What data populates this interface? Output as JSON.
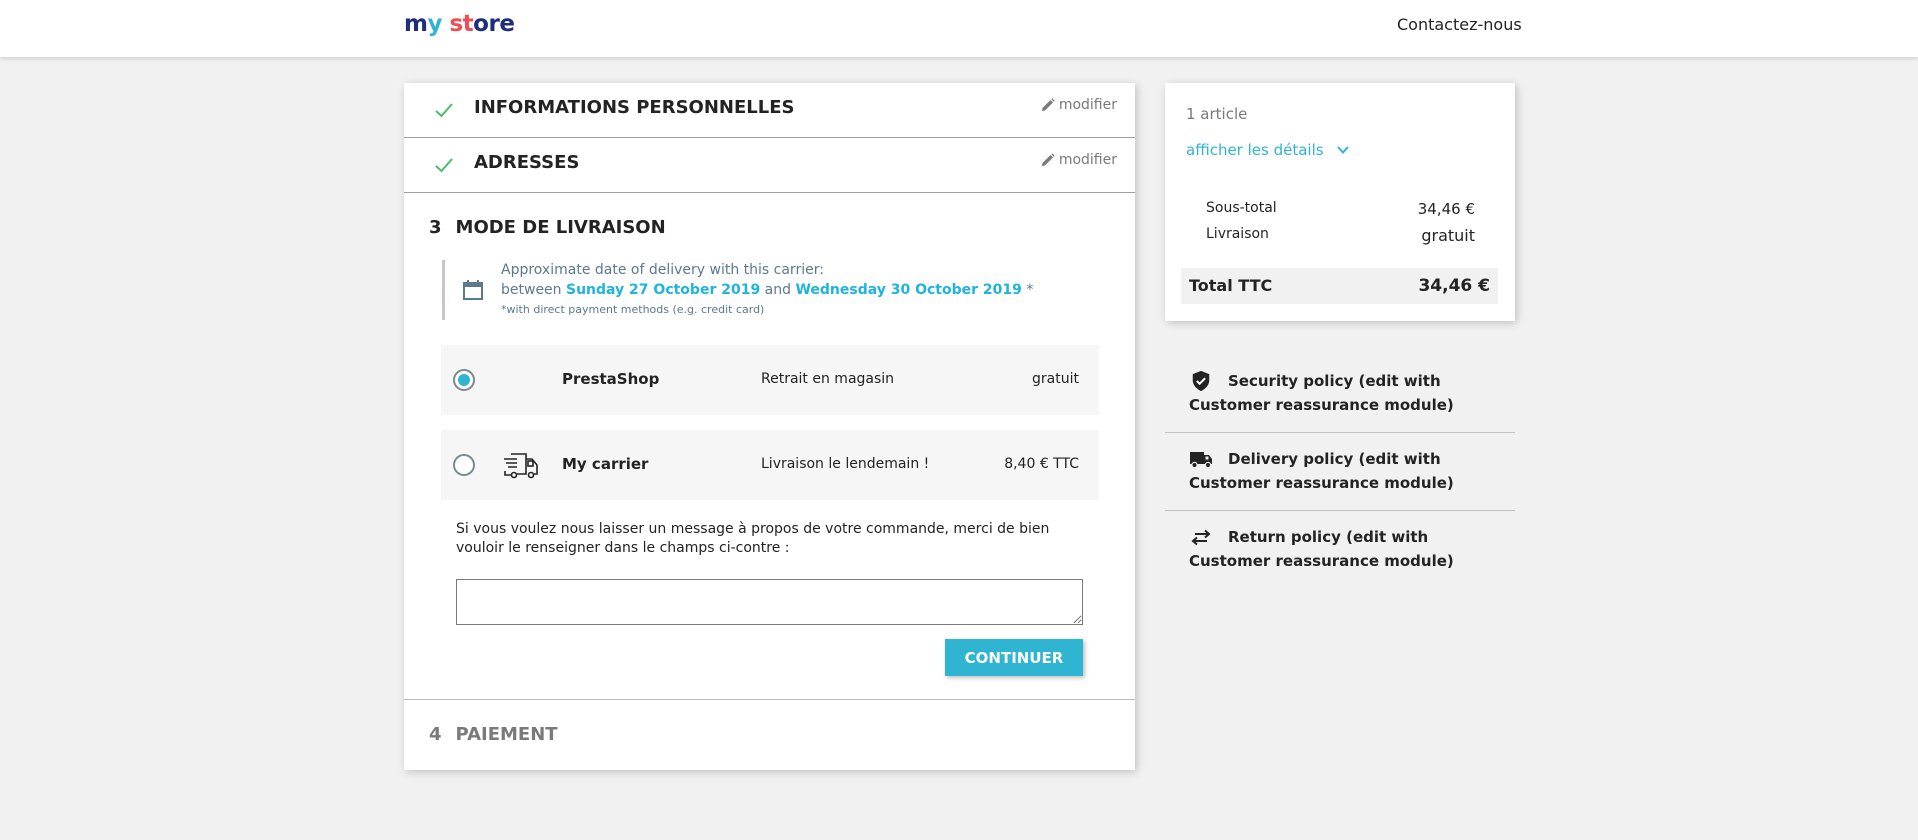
{
  "header": {
    "logo": {
      "parts": [
        "m",
        "y",
        " st",
        "ore"
      ],
      "alt": "my store"
    },
    "contact_link": "Contactez-nous"
  },
  "colors": {
    "accent": "#2fb5d2",
    "success_check": "#4cbb6c",
    "date_highlight": "#1fb4de",
    "muted": "#7a7a7a"
  },
  "steps": {
    "personal_info": {
      "title": "Informations personnelles",
      "edit_label": "modifier",
      "status": "complete",
      "icon": "check-icon"
    },
    "addresses": {
      "title": "Adresses",
      "edit_label": "modifier",
      "status": "complete",
      "icon": "check-icon"
    },
    "delivery": {
      "number": "3",
      "title": "MODE DE LIVRAISON",
      "delivery_estimate": {
        "line1": "Approximate date of delivery with this carrier:",
        "between": "between",
        "date_from": "Sunday 27 October 2019",
        "and": "and",
        "date_to": "Wednesday 30 October 2019",
        "asterisk": "*",
        "note": "*with direct payment methods (e.g. credit card)"
      },
      "carriers": [
        {
          "name": "PrestaShop",
          "delay": "Retrait en magasin",
          "price": "gratuit",
          "selected": true,
          "logo": null
        },
        {
          "name": "My carrier",
          "delay": "Livraison le lendemain !",
          "price": "8,40 € TTC",
          "selected": false,
          "logo": "truck-icon"
        }
      ],
      "message_label": "Si vous voulez nous laisser un message à propos de votre commande, merci de bien vouloir le renseigner dans le champs ci-contre :",
      "message_value": "",
      "continue_label": "Continuer"
    },
    "payment": {
      "number": "4",
      "title": "PAIEMENT"
    }
  },
  "cart_summary": {
    "items_count": "1 article",
    "details_toggle": "afficher les détails",
    "subtotal_label": "Sous-total",
    "subtotal_value": "34,46 €",
    "shipping_label": "Livraison",
    "shipping_value": "gratuit",
    "total_label": "Total TTC",
    "total_value": "34,46 €"
  },
  "reassurance": [
    {
      "icon": "shield-check-icon",
      "text": "Security policy (edit with Customer reassurance module)"
    },
    {
      "icon": "truck-icon",
      "text": "Delivery policy (edit with Customer reassurance module)"
    },
    {
      "icon": "swap-arrows-icon",
      "text": "Return policy (edit with Customer reassurance module)"
    }
  ]
}
